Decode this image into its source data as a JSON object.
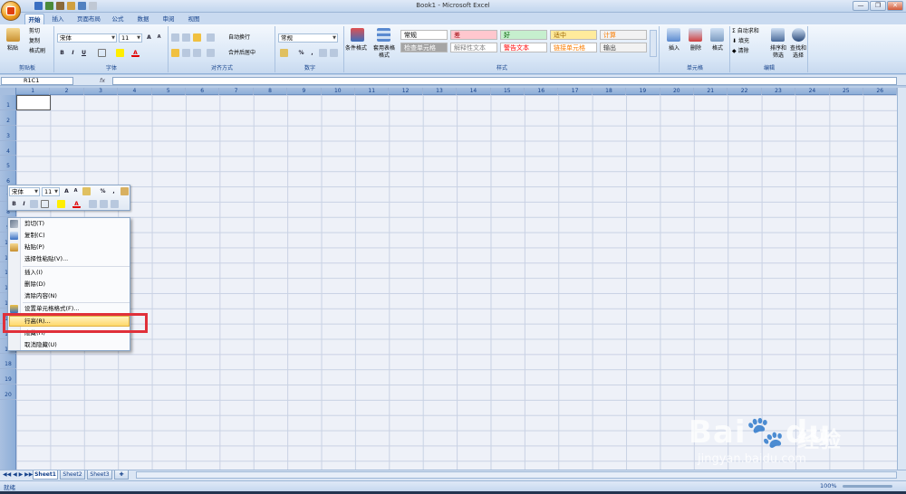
{
  "window": {
    "title": "Book1 - Microsoft Excel",
    "min": "—",
    "max": "❐",
    "close": "✕"
  },
  "tabs": [
    "开始",
    "插入",
    "页面布局",
    "公式",
    "数据",
    "审阅",
    "视图"
  ],
  "clipboard": {
    "paste": "粘贴",
    "cut": "剪切",
    "copy": "复制",
    "painter": "格式刷",
    "label": "剪贴板"
  },
  "font": {
    "name": "宋体",
    "size": "11",
    "label": "字体",
    "bold": "B",
    "italic": "I",
    "underline": "U",
    "grow": "A",
    "shrink": "A",
    "color": "A"
  },
  "alignment": {
    "wrap": "自动换行",
    "merge": "合并后居中",
    "label": "对齐方式"
  },
  "number": {
    "format": "常规",
    "percent": "%",
    "comma": ",",
    "label": "数字"
  },
  "styles": {
    "conditional": "条件格式",
    "table": "套用表格格式",
    "label": "样式",
    "cells": [
      {
        "text": "常规",
        "bg": "#ffffff",
        "fg": "#000000"
      },
      {
        "text": "差",
        "bg": "#ffc7ce",
        "fg": "#9c0006"
      },
      {
        "text": "好",
        "bg": "#c6efce",
        "fg": "#006100"
      },
      {
        "text": "适中",
        "bg": "#ffeb9c",
        "fg": "#9c6500"
      },
      {
        "text": "计算",
        "bg": "#f2f2f2",
        "fg": "#fa7d00"
      },
      {
        "text": "检查单元格",
        "bg": "#a5a5a5",
        "fg": "#ffffff"
      },
      {
        "text": "解释性文本",
        "bg": "#ffffff",
        "fg": "#7f7f7f"
      },
      {
        "text": "警告文本",
        "bg": "#ffffff",
        "fg": "#ff0000"
      },
      {
        "text": "链接单元格",
        "bg": "#ffffff",
        "fg": "#fa7d00"
      },
      {
        "text": "输出",
        "bg": "#f2f2f2",
        "fg": "#3f3f3f"
      }
    ]
  },
  "cells_group": {
    "insert": "插入",
    "delete": "删除",
    "format": "格式",
    "label": "单元格"
  },
  "editing": {
    "autosum": "自动求和",
    "fill": "填充",
    "clear": "清除",
    "sort": "排序和筛选",
    "find": "查找和选择",
    "label": "编辑"
  },
  "formula_bar": {
    "name_box": "R1C1",
    "fx": "fx",
    "value": ""
  },
  "columns": [
    "1",
    "2",
    "3",
    "4",
    "5",
    "6",
    "7",
    "8",
    "9",
    "10",
    "11",
    "12",
    "13",
    "14",
    "15",
    "16",
    "17",
    "18",
    "19",
    "20",
    "21",
    "22",
    "23",
    "24",
    "25",
    "26"
  ],
  "rows": [
    "1",
    "2",
    "3",
    "4",
    "5",
    "6",
    "7",
    "8",
    "9",
    "10",
    "11",
    "12",
    "13",
    "14",
    "15",
    "16",
    "17",
    "18",
    "19",
    "20"
  ],
  "mini_toolbar": {
    "font": "宋体",
    "size": "11",
    "grow": "A",
    "shrink": "A",
    "percent": "%",
    "comma": ",",
    "bold": "B",
    "italic": "I",
    "color": "A"
  },
  "context_menu": [
    {
      "label": "剪切(T)",
      "icon": "scissors"
    },
    {
      "label": "复制(C)",
      "icon": "copy"
    },
    {
      "label": "粘贴(P)",
      "icon": "paste"
    },
    {
      "label": "选择性粘贴(V)...",
      "icon": ""
    },
    {
      "label": "插入(I)",
      "icon": ""
    },
    {
      "label": "删除(D)",
      "icon": ""
    },
    {
      "label": "清除内容(N)",
      "icon": ""
    },
    {
      "label": "设置单元格格式(F)...",
      "icon": "format-cells"
    },
    {
      "label": "行高(R)...",
      "icon": ""
    },
    {
      "label": "隐藏(H)",
      "icon": ""
    },
    {
      "label": "取消隐藏(U)",
      "icon": ""
    }
  ],
  "sheets": [
    "Sheet1",
    "Sheet2",
    "Sheet3"
  ],
  "status": {
    "ready": "就绪",
    "zoom": "100%"
  },
  "watermark": {
    "brand": "Bai",
    "brand2": "du",
    "cn": "经验",
    "url": "jingyan.baidu.com"
  }
}
